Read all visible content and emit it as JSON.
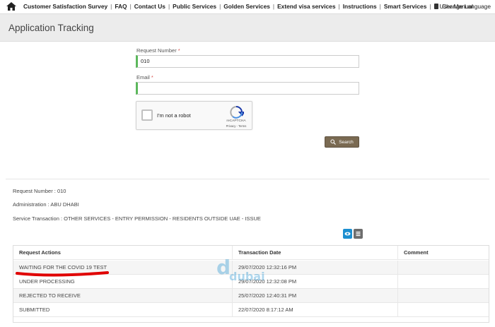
{
  "nav": {
    "items": [
      "Customer Satisfaction Survey",
      "FAQ",
      "Contact Us",
      "Public Services",
      "Golden Services",
      "Extend visa services",
      "Instructions",
      "Smart Services"
    ],
    "user_manual": "User Manual",
    "change_language": "Change Language"
  },
  "header": {
    "title": "Application Tracking"
  },
  "form": {
    "request_number_label": "Request Number",
    "request_number_value": "010",
    "email_label": "Email",
    "email_value": "",
    "required_mark": "*",
    "captcha_label": "I'm not a robot",
    "captcha_brand": "reCAPTCHA",
    "captcha_links": "Privacy - Terms",
    "search_label": "Search"
  },
  "info": {
    "request_number": "Request Number : 010",
    "administration": "Administration : ABU DHABI",
    "service_transaction": "Service Transaction : OTHER SERVICES - ENTRY PERMISSION - RESIDENTS OUTSIDE UAE - ISSUE"
  },
  "table": {
    "headers": [
      "Request Actions",
      "Transaction Date",
      "Comment"
    ],
    "rows": [
      {
        "action": "WAITING FOR THE COVID 19 TEST",
        "date": "29/07/2020 12:32:16 PM",
        "comment": ""
      },
      {
        "action": "UNDER PROCESSING",
        "date": "29/07/2020 12:32:08 PM",
        "comment": ""
      },
      {
        "action": "REJECTED TO RECEIVE",
        "date": "25/07/2020 12:40:31 PM",
        "comment": ""
      },
      {
        "action": "SUBMITTED",
        "date": "22/07/2020 8:17:12 AM",
        "comment": ""
      }
    ]
  },
  "watermark": {
    "top": "d",
    "bottom": "dubai"
  },
  "colors": {
    "accent_blue": "#1c8fd0",
    "search_brown": "#7a6a52",
    "field_green": "#5cb85c",
    "highlight_red": "#e00000"
  }
}
